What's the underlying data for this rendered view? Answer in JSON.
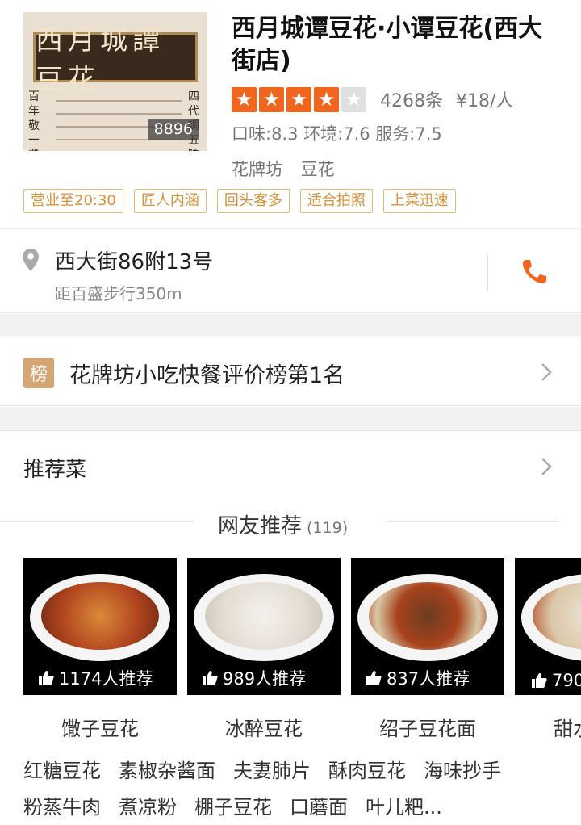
{
  "shop": {
    "name": "西月城谭豆花·小谭豆花(西大街店)",
    "photo_count": "8896",
    "sign_text": "西月城譚豆花",
    "sign_left": "百年敬一業",
    "sign_right": "四代調五味",
    "rating_stars": 4,
    "reviews": "4268条",
    "price": "¥18/人",
    "scores": "口味:8.3 环境:7.6 服务:7.5",
    "categories": [
      "花牌坊",
      "豆花"
    ],
    "tags": [
      "营业至20:30",
      "匠人内涵",
      "回头客多",
      "适合拍照",
      "上菜迅速"
    ]
  },
  "address": {
    "street": "西大街86附13号",
    "distance": "距百盛步行350m"
  },
  "ranking": {
    "badge": "榜",
    "text": "花牌坊小吃快餐评价榜第1名"
  },
  "recommend": {
    "title": "推荐菜",
    "subheading": "网友推荐",
    "subcount": "(119)",
    "dishes": [
      {
        "name": "馓子豆花",
        "recommend": "1174人推荐"
      },
      {
        "name": "冰醉豆花",
        "recommend": "989人推荐"
      },
      {
        "name": "绍子豆花面",
        "recommend": "837人推荐"
      },
      {
        "name": "甜水",
        "recommend": "790"
      }
    ],
    "more": [
      "红糖豆花",
      "素椒杂酱面",
      "夫妻肺片",
      "酥肉豆花",
      "海味抄手",
      "粉蒸牛肉",
      "煮凉粉",
      "棚子豆花",
      "口蘑面",
      "叶儿粑..."
    ]
  },
  "colors": {
    "accent": "#f2651f",
    "tag": "#d9913a",
    "badge": "#d5a675"
  }
}
